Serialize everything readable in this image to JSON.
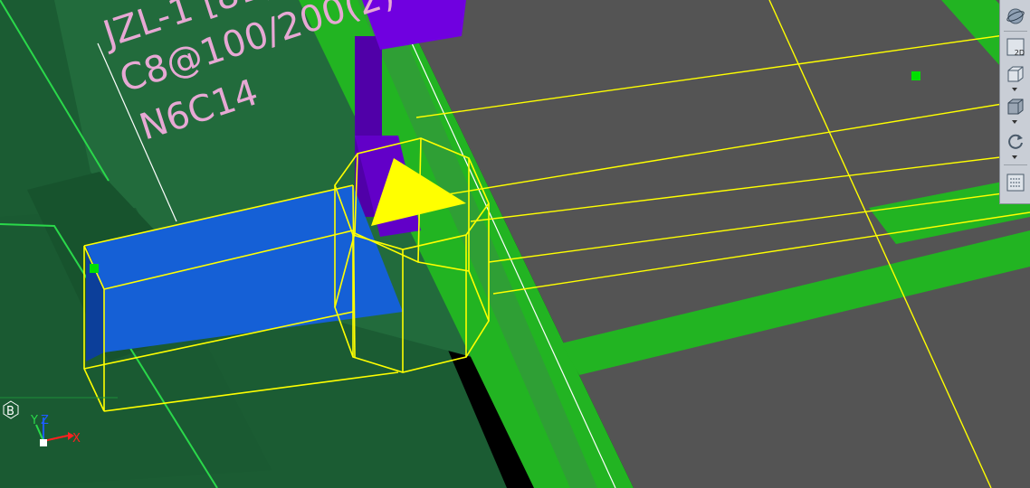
{
  "annotation": {
    "line1": "JZL-1 [81]",
    "line2": "C8@100/200(2) 4C",
    "line3": "N6C14"
  },
  "colors": {
    "background": "#000000",
    "floor_slab": "#545454",
    "green_beam": "#22b422",
    "dark_green": "#1f6b3a",
    "column_blue": "#1560d6",
    "purple_column": "#7000e0",
    "selection_yellow": "#ffff00",
    "annotation_pink": "#e7a8d4"
  },
  "ucs": {
    "badge": "B",
    "x_label": "X",
    "y_label": "Y",
    "z_label": "Z"
  },
  "toolbar": {
    "orbit_icon": "orbit-icon",
    "view_2d_label": "2D",
    "view_3d_icon": "cube-view-icon",
    "shade_icon": "shaded-cube-icon",
    "rotate_icon": "rotate-icon",
    "layers_icon": "layer-panel-icon"
  }
}
